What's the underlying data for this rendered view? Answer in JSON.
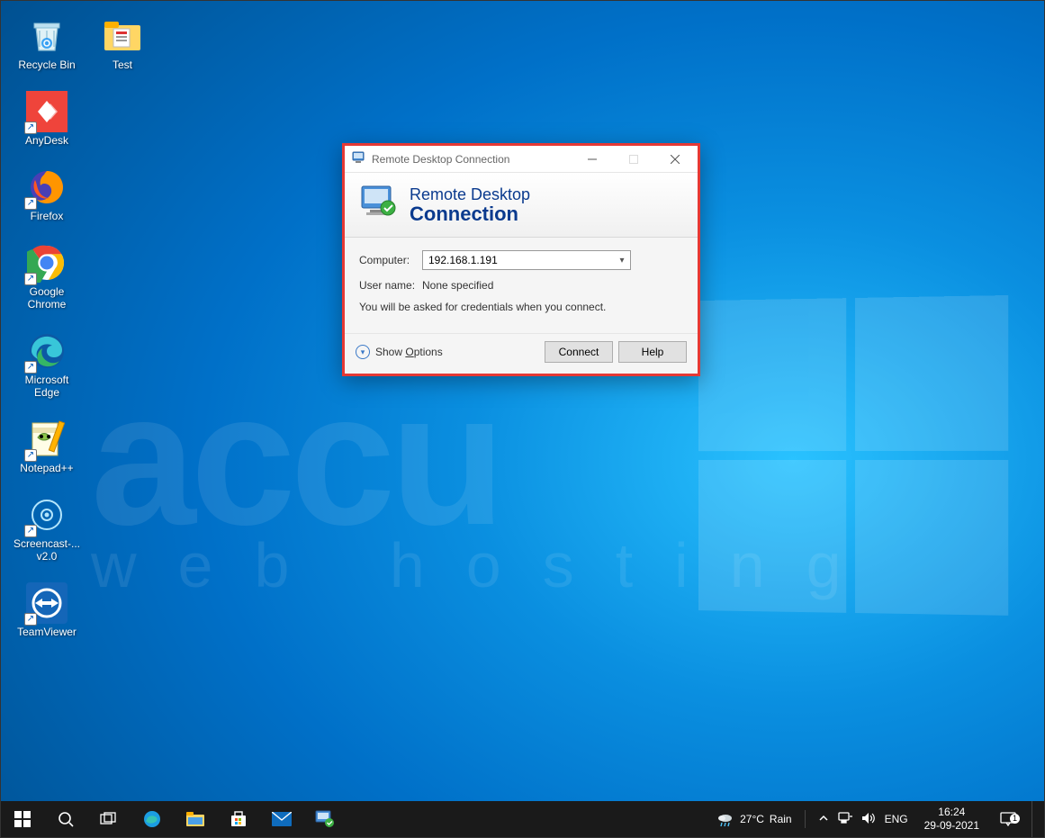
{
  "desktop_icons_col1": [
    {
      "label": "Recycle Bin",
      "name": "recycle-bin-icon",
      "kind": "recyclebin"
    },
    {
      "label": "AnyDesk",
      "name": "anydesk-icon",
      "kind": "anydesk",
      "shortcut": true
    },
    {
      "label": "Firefox",
      "name": "firefox-icon",
      "kind": "firefox",
      "shortcut": true
    },
    {
      "label": "Google Chrome",
      "name": "chrome-icon",
      "kind": "chrome",
      "shortcut": true
    },
    {
      "label": "Microsoft Edge",
      "name": "edge-icon",
      "kind": "edge",
      "shortcut": true
    },
    {
      "label": "Notepad++",
      "name": "notepadpp-icon",
      "kind": "notepadpp",
      "shortcut": true
    },
    {
      "label": "Screencast-... v2.0",
      "name": "screencast-icon",
      "kind": "screencast",
      "shortcut": true
    },
    {
      "label": "TeamViewer",
      "name": "teamviewer-icon",
      "kind": "teamviewer",
      "shortcut": true
    }
  ],
  "desktop_icons_col2": [
    {
      "label": "Test",
      "name": "test-folder-icon",
      "kind": "folder"
    }
  ],
  "watermark": {
    "line1": "accu",
    "line2": "web hosting"
  },
  "rdc": {
    "window_title": "Remote Desktop Connection",
    "banner1": "Remote Desktop",
    "banner2": "Connection",
    "computer_label": "Computer:",
    "computer_value": "192.168.1.191",
    "username_label": "User name:",
    "username_value": "None specified",
    "credentials_note": "You will be asked for credentials when you connect.",
    "show_options": "Show Options",
    "connect_label": "Connect",
    "help_label": "Help"
  },
  "taskbar": {
    "weather_temp": "27°C",
    "weather_text": "Rain",
    "lang": "ENG",
    "time": "16:24",
    "date": "29-09-2021",
    "notif_count": "1"
  }
}
